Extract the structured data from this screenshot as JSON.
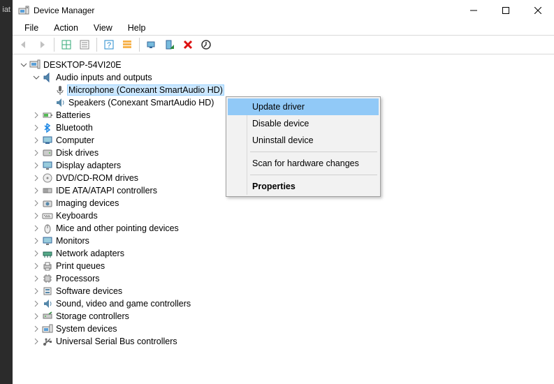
{
  "left_strip_text": "iat",
  "window": {
    "title": "Device Manager"
  },
  "menubar": [
    "File",
    "Action",
    "View",
    "Help"
  ],
  "tree": {
    "root": "DESKTOP-54VI20E",
    "audio_category": "Audio inputs and outputs",
    "audio_children": [
      "Microphone (Conexant SmartAudio HD)",
      "Speakers (Conexant SmartAudio HD)"
    ],
    "categories": [
      "Batteries",
      "Bluetooth",
      "Computer",
      "Disk drives",
      "Display adapters",
      "DVD/CD-ROM drives",
      "IDE ATA/ATAPI controllers",
      "Imaging devices",
      "Keyboards",
      "Mice and other pointing devices",
      "Monitors",
      "Network adapters",
      "Print queues",
      "Processors",
      "Software devices",
      "Sound, video and game controllers",
      "Storage controllers",
      "System devices",
      "Universal Serial Bus controllers"
    ]
  },
  "context_menu": {
    "items": [
      {
        "label": "Update driver",
        "highlight": true
      },
      {
        "label": "Disable device"
      },
      {
        "label": "Uninstall device"
      },
      {
        "sep": true
      },
      {
        "label": "Scan for hardware changes"
      },
      {
        "sep": true
      },
      {
        "label": "Properties",
        "bold": true
      }
    ]
  }
}
